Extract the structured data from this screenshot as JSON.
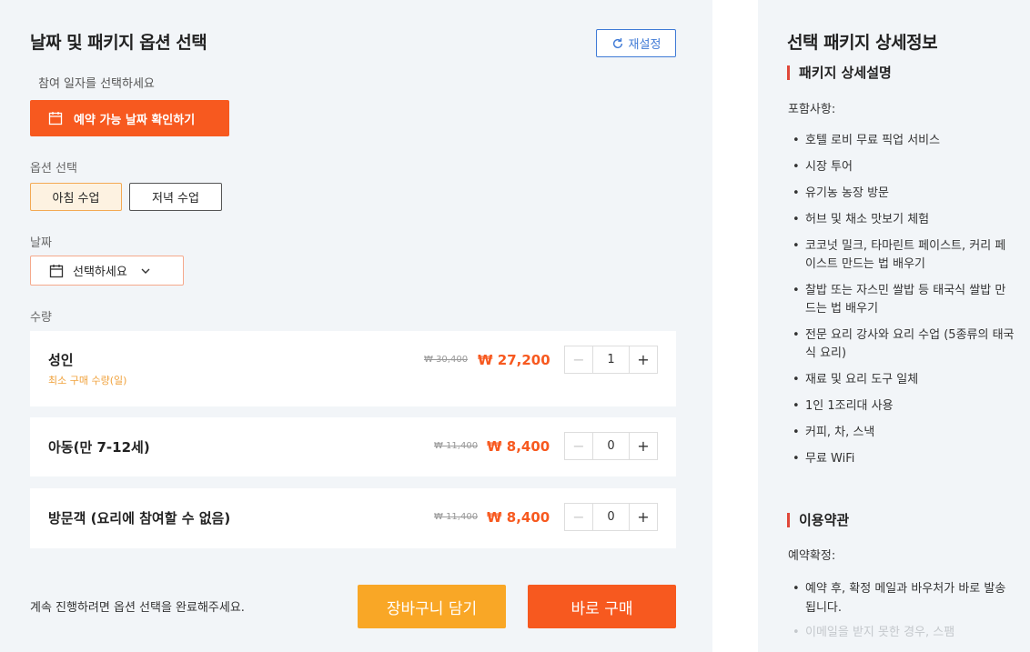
{
  "options_panel": {
    "title": "날짜 및 패키지 옵션 선택",
    "reset_label": "재설정",
    "date_hint": "참여 일자를 선택하세요",
    "check_dates_label": "예약 가능 날짜 확인하기",
    "option_label": "옵션 선택",
    "options": [
      "아침 수업",
      "저녁 수업"
    ],
    "selected_option": "아침 수업",
    "date_label": "날짜",
    "date_placeholder": "선택하세요",
    "quantity_label": "수량",
    "quantities": [
      {
        "name": "성인",
        "note": "최소 구매 수량(일)",
        "old_price": "₩ 30,400",
        "new_price": "₩ 27,200",
        "count": "1"
      },
      {
        "name": "아동(만 7-12세)",
        "note": "",
        "old_price": "₩ 11,400",
        "new_price": "₩ 8,400",
        "count": "0"
      },
      {
        "name": "방문객 (요리에 참여할 수 없음)",
        "note": "",
        "old_price": "₩ 11,400",
        "new_price": "₩ 8,400",
        "count": "0"
      }
    ],
    "footer_message": "계속 진행하려면 옵션 선택을 완료해주세요.",
    "cart_label": "장바구니 담기",
    "buy_label": "바로 구매"
  },
  "details_panel": {
    "title": "선택 패키지 상세정보",
    "description_heading": "패키지 상세설명",
    "includes_label": "포함사항:",
    "includes": [
      "호텔 로비 무료 픽업 서비스",
      "시장 투어",
      "유기농 농장 방문",
      "허브 및 채소 맛보기 체험",
      "코코넛 밀크, 타마린트 페이스트, 커리 페이스트 만드는 법 배우기",
      "찰밥 또는 자스민 쌀밥 등 태국식 쌀밥 만드는 법 배우기",
      "전문 요리 강사와 요리 수업 (5종류의 태국식 요리)",
      "재료 및 요리 도구 일체",
      "1인 1조리대 사용",
      "커피, 차, 스낵",
      "무료 WiFi"
    ],
    "terms_heading": "이용약관",
    "confirm_label": "예약확정:",
    "terms": [
      "예약 후, 확정 메일과 바우처가 바로 발송됩니다.",
      "이메일을 받지 못한 경우, 스팸"
    ]
  },
  "colors": {
    "accent_orange": "#f7591f",
    "cart_yellow": "#f9a726",
    "reset_blue": "#3f7ad6",
    "section_bar_red": "#e0483a",
    "panel_bg": "#f2f5f8"
  }
}
